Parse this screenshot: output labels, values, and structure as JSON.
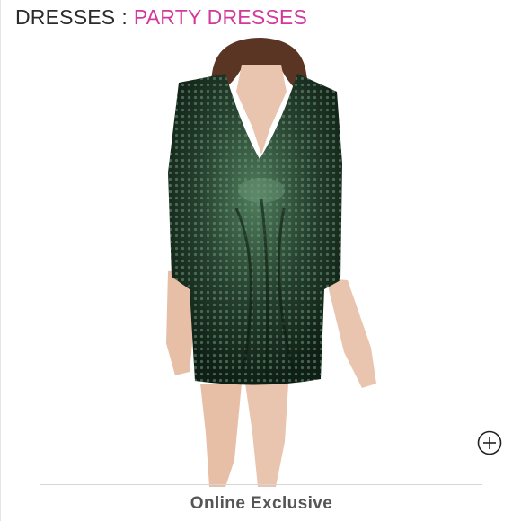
{
  "breadcrumb": {
    "category": "DRESSES",
    "separator": ":",
    "subcategory": "PARTY DRESSES"
  },
  "product": {
    "image_icon": "product-photo-sequin-dress",
    "colors": {
      "sequin": "#1f3d2a",
      "sequin_highlight": "#6f9a7a",
      "skin": "#e9c4ae"
    }
  },
  "zoom": {
    "icon": "zoom-plus-icon"
  },
  "footer": {
    "label": "Online Exclusive"
  },
  "theme": {
    "accent": "#d2399a",
    "text": "#2b2b2b",
    "muted": "#555555"
  }
}
